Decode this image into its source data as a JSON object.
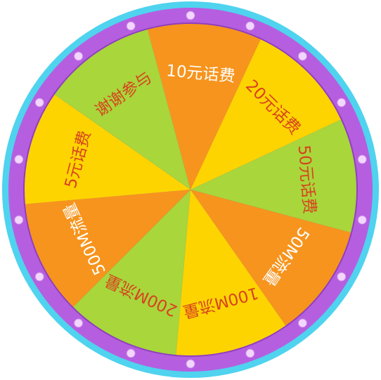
{
  "wheel": {
    "colors": {
      "outer_rim": "#4fd3ee",
      "ring": "#b65ee0",
      "ring_dark": "#8f3fbf",
      "bead": "#f2d6ff",
      "text_light": "#ffffff",
      "text_dark": "#d8431f"
    },
    "segments": [
      {
        "label": "10元话费",
        "color": "#f7941d",
        "text_color": "#ffffff"
      },
      {
        "label": "20元话费",
        "color": "#fdd400",
        "text_color": "#d8431f"
      },
      {
        "label": "50元话费",
        "color": "#a8d63b",
        "text_color": "#d8431f"
      },
      {
        "label": "50M流量",
        "color": "#f7941d",
        "text_color": "#ffffff"
      },
      {
        "label": "100M流量",
        "color": "#fdd400",
        "text_color": "#d8431f"
      },
      {
        "label": "200M流量",
        "color": "#a8d63b",
        "text_color": "#d8431f"
      },
      {
        "label": "500M流量",
        "color": "#f7941d",
        "text_color": "#ffffff"
      },
      {
        "label": "5元话费",
        "color": "#fdd400",
        "text_color": "#d8431f"
      },
      {
        "label": "谢谢参与",
        "color": "#a8d63b",
        "text_color": "#d8431f"
      }
    ]
  }
}
